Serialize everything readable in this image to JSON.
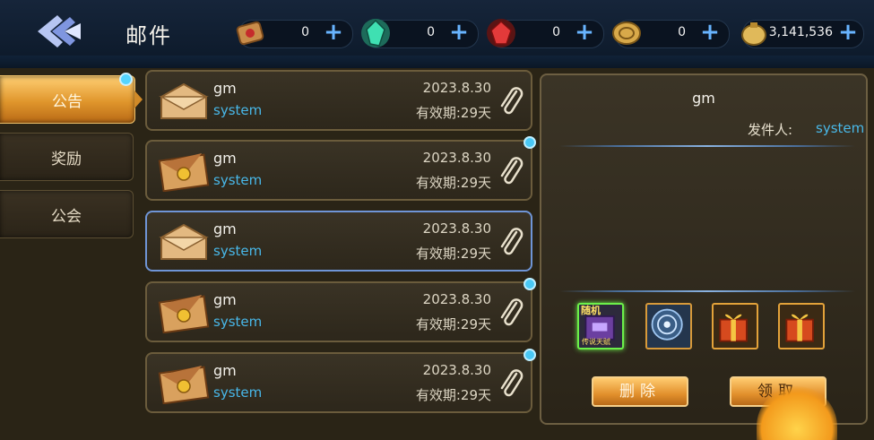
{
  "header": {
    "title": "邮件",
    "back_icon": "back-arrow-icon",
    "currencies": [
      {
        "name": "scroll-ticket",
        "icon": "scroll-icon",
        "value": "0"
      },
      {
        "name": "green-gem",
        "icon": "green-gem-icon",
        "value": "0"
      },
      {
        "name": "red-gem",
        "icon": "red-gem-icon",
        "value": "0"
      },
      {
        "name": "gold-coin",
        "icon": "coin-icon",
        "value": "0"
      },
      {
        "name": "gold-bag",
        "icon": "gold-bag-icon",
        "value": "3,141,536"
      }
    ]
  },
  "sidebar": {
    "tabs": [
      {
        "label": "公告",
        "active": true,
        "has_dot": true
      },
      {
        "label": "奖励",
        "active": false,
        "has_dot": false
      },
      {
        "label": "公会",
        "active": false,
        "has_dot": false
      }
    ]
  },
  "mail_list": [
    {
      "sender": "gm",
      "source": "system",
      "date": "2023.8.30",
      "expiry": "有效期:29天",
      "opened": true,
      "selected": false,
      "unread_dot": false
    },
    {
      "sender": "gm",
      "source": "system",
      "date": "2023.8.30",
      "expiry": "有效期:29天",
      "opened": false,
      "selected": false,
      "unread_dot": true
    },
    {
      "sender": "gm",
      "source": "system",
      "date": "2023.8.30",
      "expiry": "有效期:29天",
      "opened": true,
      "selected": true,
      "unread_dot": false
    },
    {
      "sender": "gm",
      "source": "system",
      "date": "2023.8.30",
      "expiry": "有效期:29天",
      "opened": false,
      "selected": false,
      "unread_dot": true
    },
    {
      "sender": "gm",
      "source": "system",
      "date": "2023.8.30",
      "expiry": "有效期:29天",
      "opened": false,
      "selected": false,
      "unread_dot": true
    }
  ],
  "detail": {
    "title": "gm",
    "from_label": "发件人:",
    "from_value": "system",
    "rewards": [
      {
        "icon": "random-chest-icon",
        "tag": "随机",
        "subtag": "传说天赋"
      },
      {
        "icon": "radar-orb-icon"
      },
      {
        "icon": "gift-box-icon"
      },
      {
        "icon": "gift-box-icon"
      }
    ],
    "delete_label": "删除",
    "claim_label": "领取"
  },
  "colors": {
    "accent_blue": "#48b7e8",
    "tab_active": "#e0962c",
    "panel_border": "#6b5c3c",
    "selected_border": "#6f95d6"
  }
}
